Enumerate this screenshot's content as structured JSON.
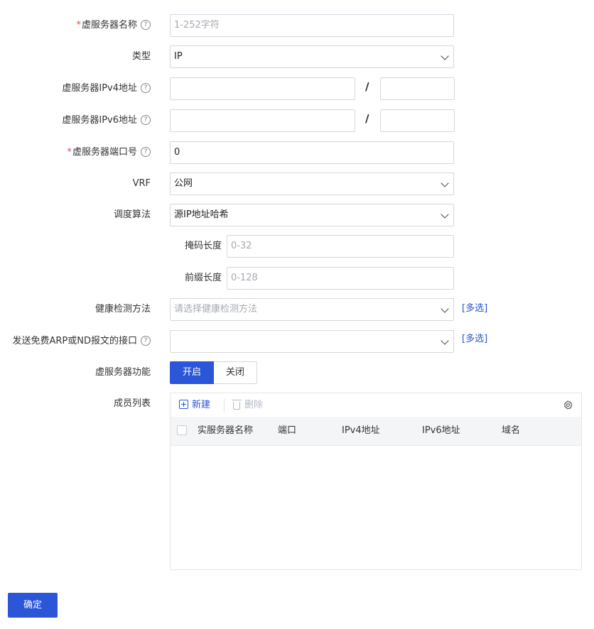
{
  "form": {
    "name": {
      "label": "虚服务器名称",
      "required_mark": "*",
      "help": "?",
      "placeholder": "1-252字符"
    },
    "type": {
      "label": "类型",
      "value": "IP"
    },
    "ipv4": {
      "label": "虚服务器IPv4地址",
      "help": "?",
      "slash": "/"
    },
    "ipv6": {
      "label": "虚服务器IPv6地址",
      "help": "?",
      "slash": "/"
    },
    "port": {
      "label": "虚服务器端口号",
      "required_mark": "*",
      "help": "?",
      "value": "0"
    },
    "vrf": {
      "label": "VRF",
      "value": "公网"
    },
    "algorithm": {
      "label": "调度算法",
      "value": "源IP地址哈希"
    },
    "mask_length": {
      "label": "掩码长度",
      "placeholder": "0-32"
    },
    "prefix_length": {
      "label": "前缀长度",
      "placeholder": "0-128"
    },
    "health_check": {
      "label": "健康检测方法",
      "placeholder": "请选择健康检测方法",
      "link": "[多选]"
    },
    "arp_interface": {
      "label": "发送免费ARP或ND报文的接口",
      "help": "?",
      "link": "[多选]"
    },
    "function": {
      "label": "虚服务器功能",
      "on": "开启",
      "off": "关闭"
    },
    "members": {
      "label": "成员列表",
      "new": "新建",
      "delete": "删除",
      "columns": [
        "实服务器名称",
        "端口",
        "IPv4地址",
        "IPv6地址",
        "域名"
      ]
    }
  },
  "confirm_label": "确定",
  "colors": {
    "primary": "#2b56d8",
    "required": "#e5484d",
    "link": "#2654d1"
  }
}
